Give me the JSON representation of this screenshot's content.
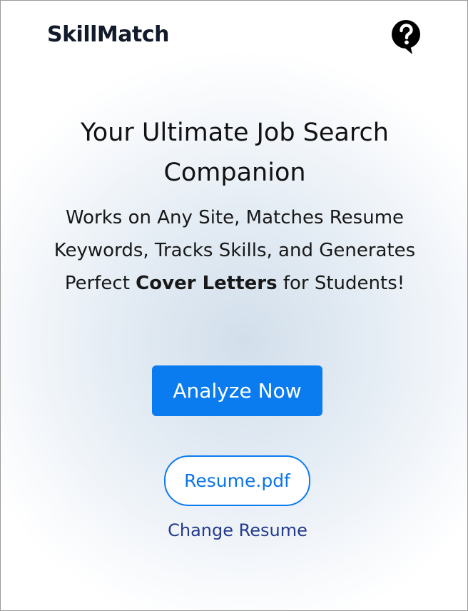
{
  "header": {
    "brand": "SkillMatch",
    "help_icon": "question-bubble-icon"
  },
  "hero": {
    "headline": "Your Ultimate Job Search Companion",
    "subtext_before": "Works on Any Site, Matches Resume Keywords, Tracks Skills, and Generates Perfect ",
    "subtext_bold": "Cover Letters",
    "subtext_after": " for Students!"
  },
  "actions": {
    "analyze_label": "Analyze Now",
    "resume_file": "Resume.pdf",
    "change_resume_label": "Change Resume"
  },
  "colors": {
    "primary": "#0b7bf0",
    "link": "#233a8e",
    "brand_text": "#121a2c"
  }
}
